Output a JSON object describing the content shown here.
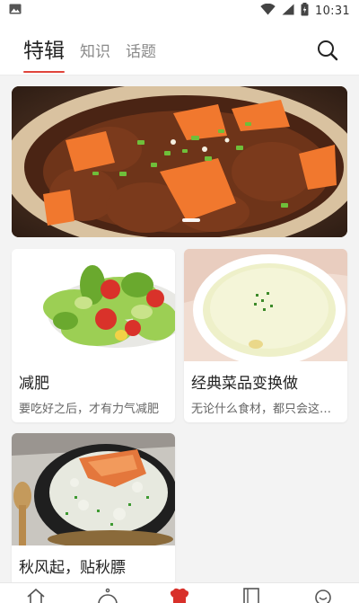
{
  "status_bar": {
    "time": "10:31",
    "icons": [
      "image-icon",
      "wifi-icon",
      "signal-icon",
      "battery-icon"
    ]
  },
  "header": {
    "tabs": [
      {
        "label": "特辑",
        "active": true
      },
      {
        "label": "知识",
        "active": false
      },
      {
        "label": "话题",
        "active": false
      }
    ],
    "search_icon": "search-icon"
  },
  "banner": {
    "image": "braised-meat-carrot-pot",
    "slide_indicator": "1"
  },
  "cards": [
    {
      "title": "减肥",
      "desc": "要吃好之后，才有力气减肥",
      "image": "salad"
    },
    {
      "title": "经典菜品变换做",
      "desc": "无论什么食材，都只会这样做",
      "image": "creamy-soup"
    },
    {
      "title": "秋风起，贴秋膘",
      "desc": "",
      "image": "congee-pot"
    }
  ],
  "bottom_nav": {
    "items": [
      {
        "icon": "home-icon",
        "active": false
      },
      {
        "icon": "cloche-icon",
        "active": false
      },
      {
        "icon": "chef-hat-icon",
        "active": true
      },
      {
        "icon": "book-icon",
        "active": false
      },
      {
        "icon": "profile-icon",
        "active": false
      }
    ]
  },
  "colors": {
    "accent": "#e0443b",
    "background": "#f3f3f3",
    "card": "#ffffff",
    "tab_inactive": "#8a8a8a"
  }
}
